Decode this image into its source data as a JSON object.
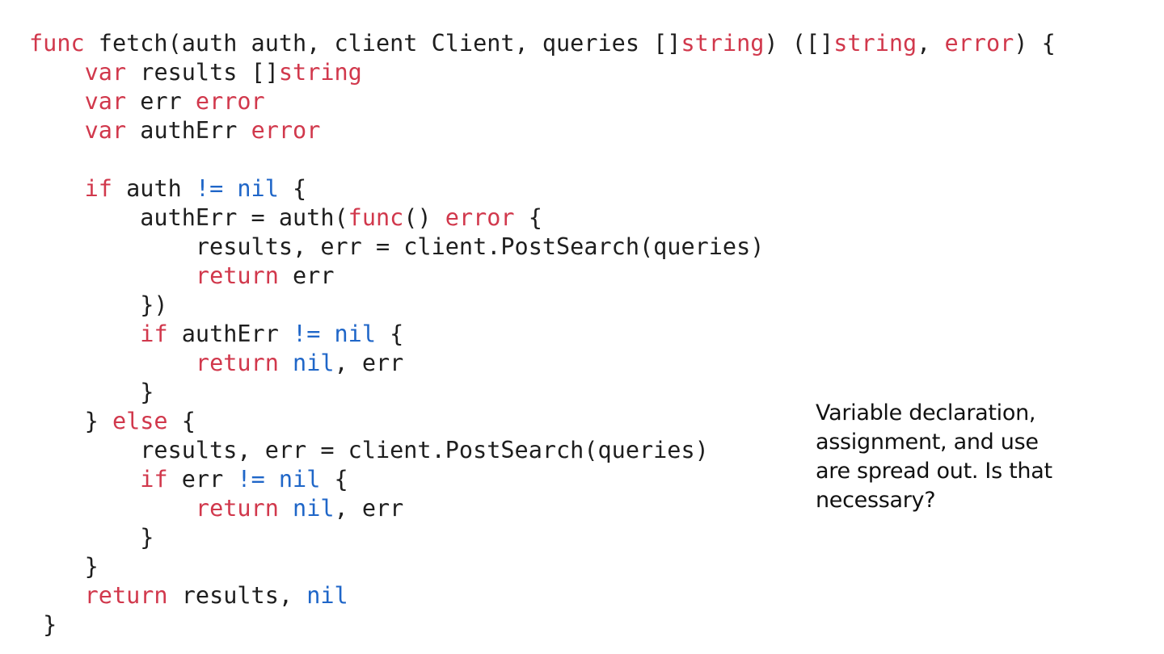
{
  "colors": {
    "keyword": "#d1384c",
    "type": "#d1384c",
    "operator": "#1f66c8",
    "plain": "#1e1e1e",
    "background": "#ffffff"
  },
  "code": {
    "lines": [
      [
        [
          "keyword",
          "func"
        ],
        [
          "plain",
          " fetch(auth auth, client Client, queries []"
        ],
        [
          "type",
          "string"
        ],
        [
          "plain",
          ") ([]"
        ],
        [
          "type",
          "string"
        ],
        [
          "plain",
          ", "
        ],
        [
          "type",
          "error"
        ],
        [
          "plain",
          ") {"
        ]
      ],
      [
        [
          "plain",
          "    "
        ],
        [
          "keyword",
          "var"
        ],
        [
          "plain",
          " results []"
        ],
        [
          "type",
          "string"
        ]
      ],
      [
        [
          "plain",
          "    "
        ],
        [
          "keyword",
          "var"
        ],
        [
          "plain",
          " err "
        ],
        [
          "type",
          "error"
        ]
      ],
      [
        [
          "plain",
          "    "
        ],
        [
          "keyword",
          "var"
        ],
        [
          "plain",
          " authErr "
        ],
        [
          "type",
          "error"
        ]
      ],
      [],
      [
        [
          "plain",
          "    "
        ],
        [
          "keyword",
          "if"
        ],
        [
          "plain",
          " auth "
        ],
        [
          "op",
          "!= nil"
        ],
        [
          "plain",
          " {"
        ]
      ],
      [
        [
          "plain",
          "        authErr = auth("
        ],
        [
          "keyword",
          "func"
        ],
        [
          "plain",
          "() "
        ],
        [
          "type",
          "error"
        ],
        [
          "plain",
          " {"
        ]
      ],
      [
        [
          "plain",
          "            results, err = client.PostSearch(queries)"
        ]
      ],
      [
        [
          "plain",
          "            "
        ],
        [
          "keyword",
          "return"
        ],
        [
          "plain",
          " err"
        ]
      ],
      [
        [
          "plain",
          "        })"
        ]
      ],
      [
        [
          "plain",
          "        "
        ],
        [
          "keyword",
          "if"
        ],
        [
          "plain",
          " authErr "
        ],
        [
          "op",
          "!= nil"
        ],
        [
          "plain",
          " {"
        ]
      ],
      [
        [
          "plain",
          "            "
        ],
        [
          "keyword",
          "return"
        ],
        [
          "plain",
          " "
        ],
        [
          "op",
          "nil"
        ],
        [
          "plain",
          ", err"
        ]
      ],
      [
        [
          "plain",
          "        }"
        ]
      ],
      [
        [
          "plain",
          "    } "
        ],
        [
          "keyword",
          "else"
        ],
        [
          "plain",
          " {"
        ]
      ],
      [
        [
          "plain",
          "        results, err = client.PostSearch(queries)"
        ]
      ],
      [
        [
          "plain",
          "        "
        ],
        [
          "keyword",
          "if"
        ],
        [
          "plain",
          " err "
        ],
        [
          "op",
          "!= nil"
        ],
        [
          "plain",
          " {"
        ]
      ],
      [
        [
          "plain",
          "            "
        ],
        [
          "keyword",
          "return"
        ],
        [
          "plain",
          " "
        ],
        [
          "op",
          "nil"
        ],
        [
          "plain",
          ", err"
        ]
      ],
      [
        [
          "plain",
          "        }"
        ]
      ],
      [
        [
          "plain",
          "    }"
        ]
      ],
      [
        [
          "plain",
          "    "
        ],
        [
          "keyword",
          "return"
        ],
        [
          "plain",
          " results, "
        ],
        [
          "op",
          "nil"
        ]
      ],
      [
        [
          "plain",
          " }"
        ]
      ]
    ]
  },
  "note": {
    "lines": [
      "Variable declaration,",
      "assignment, and use",
      "are spread out. Is that",
      "necessary?"
    ]
  }
}
